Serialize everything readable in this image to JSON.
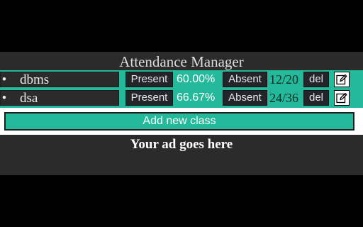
{
  "app": {
    "title": "Attendance Manager",
    "classes": [
      {
        "bullet": "•",
        "name": "dbms",
        "present_label": "Present",
        "percent": "60.00%",
        "absent_label": "Absent",
        "ratio": "12/20",
        "del_label": "del",
        "edit_icon": "edit-icon"
      },
      {
        "bullet": "•",
        "name": "dsa",
        "present_label": "Present",
        "percent": "66.67%",
        "absent_label": "Absent",
        "ratio": "24/36",
        "del_label": "del",
        "edit_icon": "edit-icon"
      }
    ],
    "add_class_label": "Add new class",
    "ad_text": "Your ad goes here"
  },
  "colors": {
    "accent": "#23b99a",
    "panel": "#2b2b2b",
    "button": "#22262b",
    "background": "#000000"
  }
}
